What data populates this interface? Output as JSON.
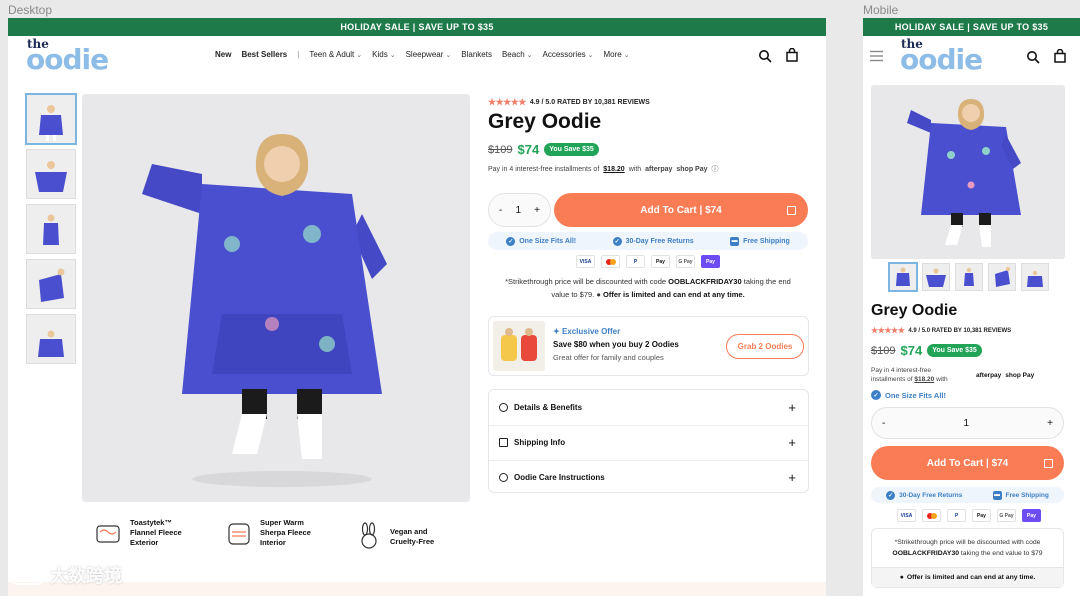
{
  "frames": {
    "desktop_label": "Desktop",
    "mobile_label": "Mobile"
  },
  "banner": "HOLIDAY SALE | SAVE UP TO $35",
  "logo": {
    "the": "the",
    "brand": "oodie"
  },
  "nav": {
    "new": "New",
    "best_sellers": "Best Sellers",
    "sep": "|",
    "items": [
      "Teen & Adult",
      "Kids",
      "Sleepwear",
      "Blankets",
      "Beach",
      "Accessories",
      "More"
    ]
  },
  "product": {
    "rating_text": "4.9 / 5.0 RATED BY 10,381 REVIEWS",
    "stars": "★★★★★",
    "title": "Grey Oodie",
    "old_price": "$109",
    "new_price": "$74",
    "save_badge": "You Save $35",
    "installments_prefix": "Pay in 4 interest-free installments of",
    "installments_amount": "$18.20",
    "installments_suffix": "with",
    "installments_prefix_mobile": "Pay in 4 interest-free installments of",
    "afterpay": "afterpay",
    "shoppay": "shop Pay",
    "qty_minus": "-",
    "qty_value": "1",
    "qty_plus": "+",
    "add_to_cart": "Add To Cart | $74"
  },
  "perks": [
    "One Size Fits All!",
    "30-Day Free Returns",
    "Free Shipping"
  ],
  "payments": [
    "VISA",
    "MC",
    "P",
    "Pay",
    "G Pay",
    "Pay"
  ],
  "note": {
    "line1": "*Strikethrough price will be discounted with code",
    "code": "OOBLACKFRIDAY30",
    "line1_end": "taking the end",
    "line2": "value to $79.",
    "limited": "Offer is limited and can end at any time."
  },
  "mobile_note": {
    "line1": "*Strikethrough price will be discounted with code",
    "code": "OOBLACKFRIDAY30",
    "line2_end": "taking the end value to $79",
    "limited": "Offer is limited and can end at any time."
  },
  "offer": {
    "tag": "Exclusive Offer",
    "title": "Save $80 when you buy 2 Oodies",
    "subtitle": "Great offer for family and couples",
    "button": "Grab 2 Oodies"
  },
  "accordion": [
    "Details & Benefits",
    "Shipping Info",
    "Oodie Care Instructions"
  ],
  "features": [
    {
      "line1": "Toastytek™",
      "line2": "Flannel Fleece",
      "line3": "Exterior"
    },
    {
      "line1": "Super Warm",
      "line2": "Sherpa Fleece",
      "line3": "Interior"
    },
    {
      "line1": "Vegan and",
      "line2": "Cruelty-Free",
      "line3": ""
    }
  ],
  "watermark": "大数跨境",
  "colors": {
    "green": "#1f7a49",
    "price_green": "#21a458",
    "accent": "#f97c55",
    "blue": "#3d7fc6",
    "logo_blue": "#8dbde6"
  }
}
